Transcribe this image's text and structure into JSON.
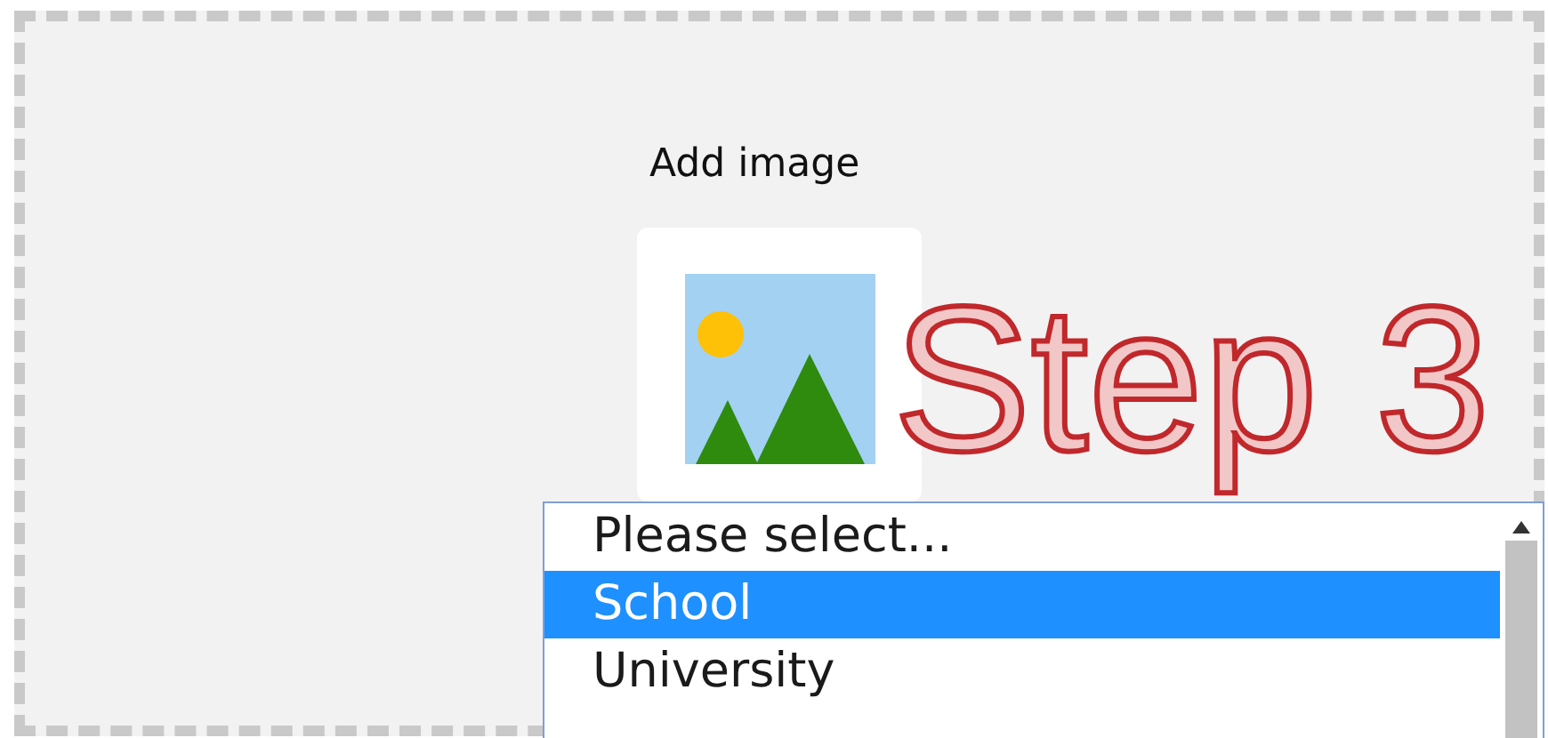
{
  "add_image": {
    "label": "Add image"
  },
  "select_list": {
    "options": [
      {
        "label": "Please select...",
        "selected": false
      },
      {
        "label": "School",
        "selected": true
      },
      {
        "label": "University",
        "selected": false
      }
    ]
  },
  "annotation": {
    "text": "Step 3"
  }
}
